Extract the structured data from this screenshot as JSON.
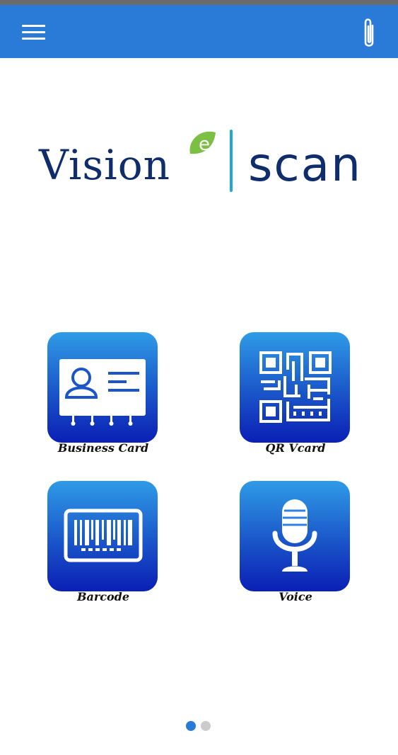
{
  "app": {
    "brand_word1": "Vision",
    "brand_word2": "scan",
    "brand_accent_letter": "e"
  },
  "colors": {
    "appbar": "#2a7bd8",
    "brand_navy": "#0f2d6b",
    "brand_divider": "#22a6d8",
    "brand_e_green": "#7bc043",
    "tile_top": "#2f9be6",
    "tile_bottom": "#0a1fb5",
    "dot_active": "#2a7bd8",
    "dot_inactive": "#cccccc"
  },
  "header": {
    "menu_icon": "hamburger-menu-icon",
    "attach_icon": "paperclip-icon"
  },
  "tiles": [
    {
      "label": "Business Card",
      "icon": "id-card-icon"
    },
    {
      "label": "QR Vcard",
      "icon": "qr-code-icon"
    },
    {
      "label": "Barcode",
      "icon": "barcode-icon"
    },
    {
      "label": "Voice",
      "icon": "microphone-icon"
    }
  ],
  "pager": {
    "pages": 2,
    "active": 1
  }
}
